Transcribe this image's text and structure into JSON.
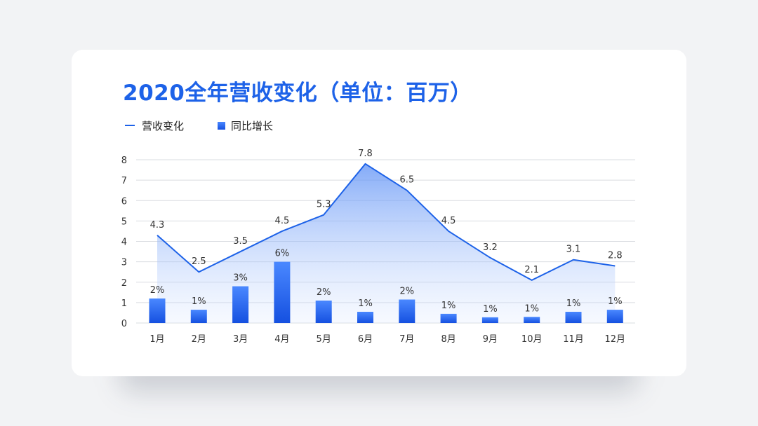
{
  "title": "2020全年营收变化（单位：百万）",
  "legend": {
    "line_label": "营收变化",
    "bar_label": "同比增长"
  },
  "colors": {
    "accent": "#1d62e8",
    "bar_top": "#4a88ff",
    "bar_bottom": "#1550e0",
    "grid": "#d9dce1",
    "text": "#333333"
  },
  "chart_data": {
    "type": "bar",
    "title": "2020全年营收变化（单位：百万）",
    "categories": [
      "1月",
      "2月",
      "3月",
      "4月",
      "5月",
      "6月",
      "7月",
      "8月",
      "9月",
      "10月",
      "11月",
      "12月"
    ],
    "y_ticks": [
      "0",
      "1",
      "2",
      "3",
      "4",
      "5",
      "6",
      "7",
      "8"
    ],
    "ylim": [
      0,
      8
    ],
    "grid": true,
    "legend_position": "top-left",
    "series": [
      {
        "name": "营收变化",
        "type": "area-line",
        "values": [
          4.3,
          2.5,
          3.5,
          4.5,
          5.3,
          7.8,
          6.5,
          4.5,
          3.2,
          2.1,
          3.1,
          2.8
        ],
        "labels": [
          "4.3",
          "2.5",
          "3.5",
          "4.5",
          "5.3",
          "7.8",
          "6.5",
          "4.5",
          "3.2",
          "2.1",
          "3.1",
          "2.8"
        ]
      },
      {
        "name": "同比增长",
        "type": "bar",
        "values": [
          1.2,
          0.65,
          1.8,
          3.0,
          1.1,
          0.55,
          1.15,
          0.45,
          0.28,
          0.3,
          0.55,
          0.65
        ],
        "labels": [
          "2%",
          "1%",
          "3%",
          "6%",
          "2%",
          "1%",
          "2%",
          "1%",
          "1%",
          "1%",
          "1%",
          "1%"
        ]
      }
    ]
  }
}
